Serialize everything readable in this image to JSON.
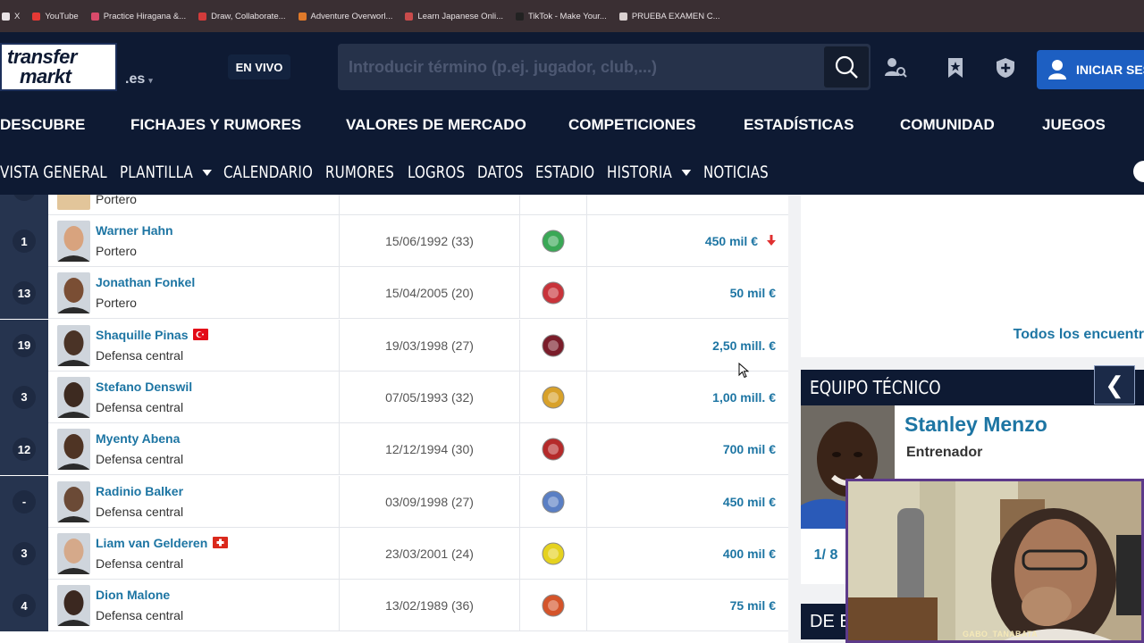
{
  "bookmarks": [
    {
      "label": "X",
      "color": "#e8e2e4"
    },
    {
      "label": "YouTube",
      "color": "#e53935"
    },
    {
      "label": "Practice Hiragana &...",
      "color": "#d84a6a"
    },
    {
      "label": "Draw, Collaborate...",
      "color": "#d23b3b"
    },
    {
      "label": "Adventure Overworl...",
      "color": "#e07a2a"
    },
    {
      "label": "Learn Japanese Onli...",
      "color": "#c94b4b"
    },
    {
      "label": "TikTok - Make Your...",
      "color": "#222222"
    },
    {
      "label": "PRUEBA EXAMEN C...",
      "color": "#d9d0d0"
    }
  ],
  "header": {
    "logo_line1": "transfer",
    "logo_line2": "markt",
    "domain": ".es",
    "live_label": "EN VIVO",
    "search_placeholder": "Introducir término (p.ej. jugador, club,...)",
    "login_label": "INICIAR SES"
  },
  "main_nav": [
    "DESCUBRE",
    "FICHAJES Y RUMORES",
    "VALORES DE MERCADO",
    "COMPETICIONES",
    "ESTADÍSTICAS",
    "COMUNIDAD",
    "JUEGOS"
  ],
  "sub_nav": [
    {
      "label": "VISTA GENERAL",
      "dropdown": false
    },
    {
      "label": "PLANTILLA",
      "dropdown": true
    },
    {
      "label": "CALENDARIO",
      "dropdown": false
    },
    {
      "label": "RUMORES",
      "dropdown": false
    },
    {
      "label": "LOGROS",
      "dropdown": false
    },
    {
      "label": "DATOS",
      "dropdown": false
    },
    {
      "label": "ESTADIO",
      "dropdown": false
    },
    {
      "label": "HISTORIA",
      "dropdown": true
    },
    {
      "label": "NOTICIAS",
      "dropdown": false
    }
  ],
  "partial_row": {
    "position": "Portero"
  },
  "players": [
    {
      "number": "1",
      "name": "Warner Hahn",
      "position": "Portero",
      "dob": "15/06/1992 (33)",
      "value": "450 mil €",
      "trend": "down",
      "flag": "",
      "club_color": "#3aa856",
      "skin": "#d8a37e"
    },
    {
      "number": "13",
      "name": "Jonathan Fonkel",
      "position": "Portero",
      "dob": "15/04/2005 (20)",
      "value": "50 mil €",
      "trend": "",
      "flag": "",
      "club_color": "#c8333a",
      "skin": "#7a4e34"
    },
    {
      "number": "19",
      "name": "Shaquille Pinas",
      "position": "Defensa central",
      "dob": "19/03/1998 (27)",
      "value": "2,50 mill. €",
      "trend": "",
      "flag": "turkey",
      "club_color": "#7a1d2a",
      "skin": "#4a3326"
    },
    {
      "number": "3",
      "name": "Stefano Denswil",
      "position": "Defensa central",
      "dob": "07/05/1993 (32)",
      "value": "1,00 mill. €",
      "trend": "",
      "flag": "",
      "club_color": "#d8a12a",
      "skin": "#3d2a20"
    },
    {
      "number": "12",
      "name": "Myenty Abena",
      "position": "Defensa central",
      "dob": "12/12/1994 (30)",
      "value": "700 mil €",
      "trend": "",
      "flag": "",
      "club_color": "#b52a2a",
      "skin": "#4f3424"
    },
    {
      "number": "-",
      "name": "Radinio Balker",
      "position": "Defensa central",
      "dob": "03/09/1998 (27)",
      "value": "450 mil €",
      "trend": "",
      "flag": "",
      "club_color": "#5a7fc4",
      "skin": "#6b4a36"
    },
    {
      "number": "3",
      "name": "Liam van Gelderen",
      "position": "Defensa central",
      "dob": "23/03/2001 (24)",
      "value": "400 mil €",
      "trend": "",
      "flag": "switzerland",
      "club_color": "#e5d21f",
      "skin": "#d5a98a"
    },
    {
      "number": "4",
      "name": "Dion Malone",
      "position": "Defensa central",
      "dob": "13/02/1989 (36)",
      "value": "75 mil €",
      "trend": "",
      "flag": "",
      "club_color": "#d4542a",
      "skin": "#3b2820"
    }
  ],
  "right_panel": {
    "all_link": "Todos los encuentr",
    "staff_header": "EQUIPO TÉCNICO",
    "arrow": "❮",
    "coach_name": "Stanley Menzo",
    "coach_role": "Entrenador",
    "pager": "1/ 8",
    "next_header": "DE ES"
  },
  "webcam": {
    "tag": "GABO_TANABATA"
  }
}
